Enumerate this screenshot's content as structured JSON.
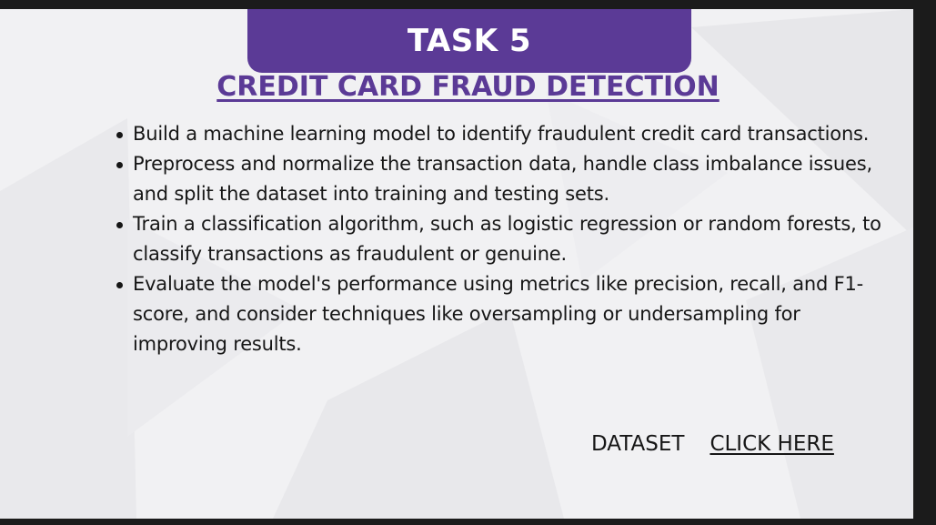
{
  "colors": {
    "accent": "#5b3a96",
    "slide_background": "#f1f1f3",
    "frame_background": "#1b1b1b",
    "text": "#161616"
  },
  "banner": {
    "title": "TASK 5"
  },
  "heading": {
    "title": "CREDIT CARD FRAUD DETECTION"
  },
  "bullets": [
    {
      "text": "Build a machine learning model to identify fraudulent credit card transactions."
    },
    {
      "text": "Preprocess and normalize the transaction data, handle class imbalance issues, and split the dataset into training and testing sets."
    },
    {
      "text": "Train a classification algorithm, such as logistic regression or random forests, to classify transactions as fraudulent or genuine."
    },
    {
      "text": "Evaluate the model's performance using metrics like precision, recall, and F1-score, and consider techniques like oversampling or undersampling for improving results."
    }
  ],
  "dataset": {
    "label": "DATASET",
    "link_label": "CLICK HERE"
  }
}
